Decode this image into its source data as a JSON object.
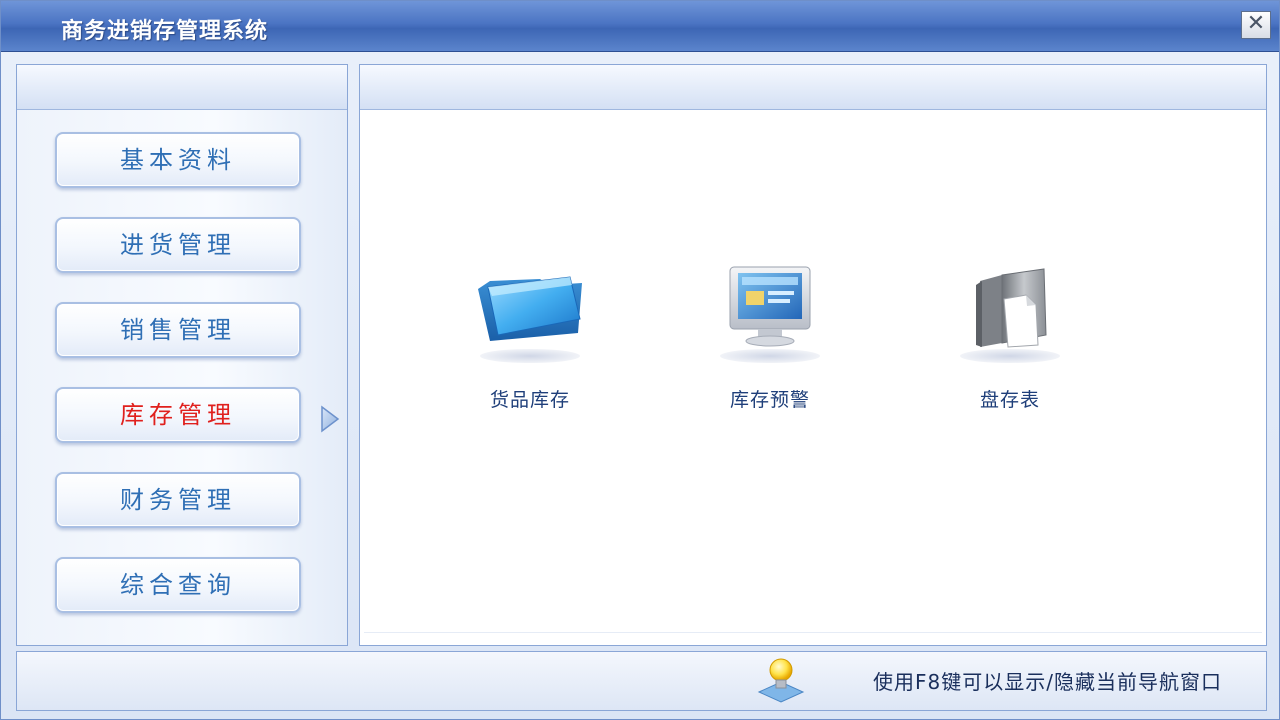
{
  "window": {
    "title": "商务进销存管理系统",
    "close_icon": "close-icon"
  },
  "nav": {
    "items": [
      {
        "label": "基本资料",
        "active": false
      },
      {
        "label": "进货管理",
        "active": false
      },
      {
        "label": "销售管理",
        "active": false
      },
      {
        "label": "库存管理",
        "active": true
      },
      {
        "label": "财务管理",
        "active": false
      },
      {
        "label": "综合查询",
        "active": false
      }
    ],
    "active_indicator_icon": "triangle-right-icon"
  },
  "main": {
    "tiles": [
      {
        "label": "货品库存",
        "icon": "folder-icon"
      },
      {
        "label": "库存预警",
        "icon": "monitor-icon"
      },
      {
        "label": "盘存表",
        "icon": "document-folder-icon"
      }
    ]
  },
  "footer": {
    "hint": "使用F8键可以显示/隐藏当前导航窗口",
    "hint_icon": "lightbulb-icon"
  },
  "colors": {
    "accent": "#3d66b5",
    "nav_text": "#2f6fb5",
    "nav_active_text": "#e0201d",
    "label_text": "#1f3f7a"
  }
}
